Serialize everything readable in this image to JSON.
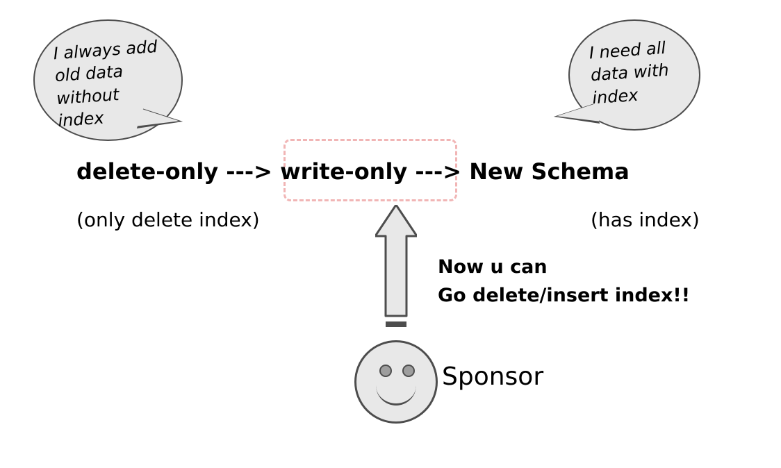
{
  "bubble_left": {
    "line1": "I always add",
    "line2": "old data",
    "line3": "without",
    "line4": "index"
  },
  "bubble_right": {
    "line1": "I need all",
    "line2": "data with",
    "line3": "index"
  },
  "flow": {
    "delete_only": "delete-only",
    "arrow1": " ---> ",
    "write_only": "write-only",
    "arrow2": "  ---> ",
    "new_schema": "  New Schema"
  },
  "sub": {
    "left": "(only delete index)",
    "right": "(has index)"
  },
  "sponsor_note": {
    "line1": "Now u can",
    "line2": "Go delete/insert index!!"
  },
  "sponsor_label": "Sponsor"
}
